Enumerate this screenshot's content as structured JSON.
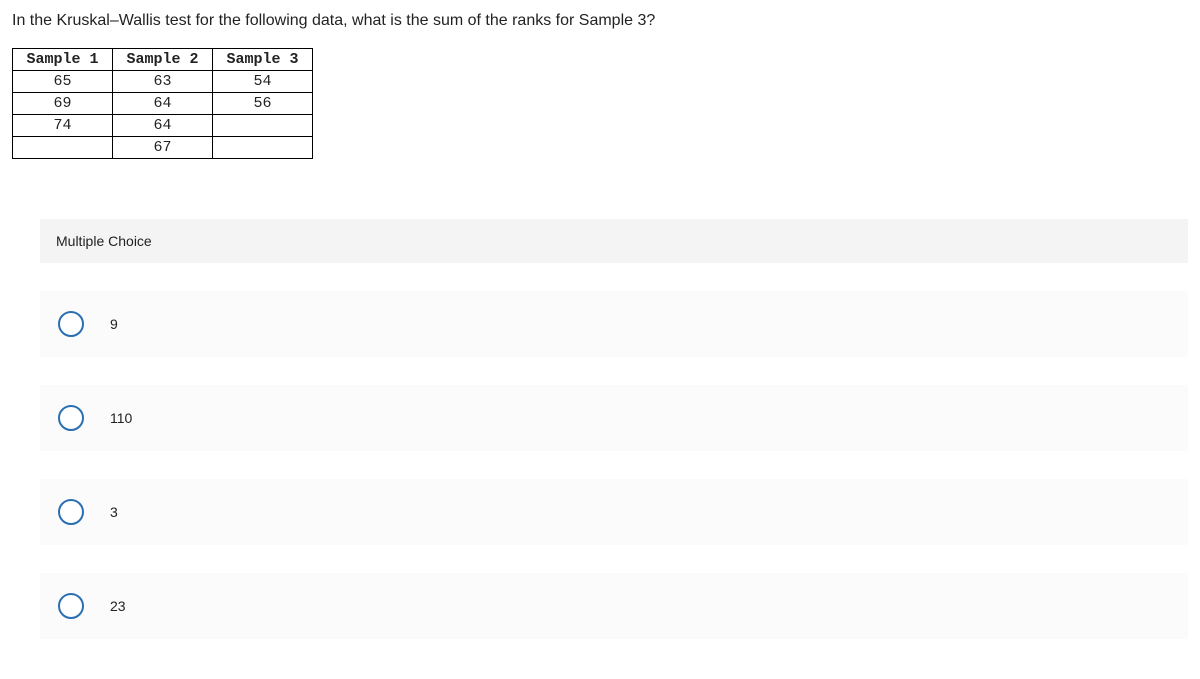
{
  "question": "In the Kruskal–Wallis test for the following data, what is the sum of the ranks for Sample 3?",
  "table": {
    "headers": [
      "Sample 1",
      "Sample 2",
      "Sample 3"
    ],
    "rows": [
      [
        "65",
        "63",
        "54"
      ],
      [
        "69",
        "64",
        "56"
      ],
      [
        "74",
        "64",
        ""
      ],
      [
        "",
        "67",
        ""
      ]
    ]
  },
  "mc_title": "Multiple Choice",
  "options": [
    {
      "label": "9"
    },
    {
      "label": "110"
    },
    {
      "label": "3"
    },
    {
      "label": "23"
    }
  ],
  "chart_data": {
    "type": "table",
    "title": "Kruskal–Wallis test data",
    "columns": [
      "Sample 1",
      "Sample 2",
      "Sample 3"
    ],
    "data": {
      "Sample 1": [
        65,
        69,
        74
      ],
      "Sample 2": [
        63,
        64,
        64,
        67
      ],
      "Sample 3": [
        54,
        56
      ]
    }
  }
}
